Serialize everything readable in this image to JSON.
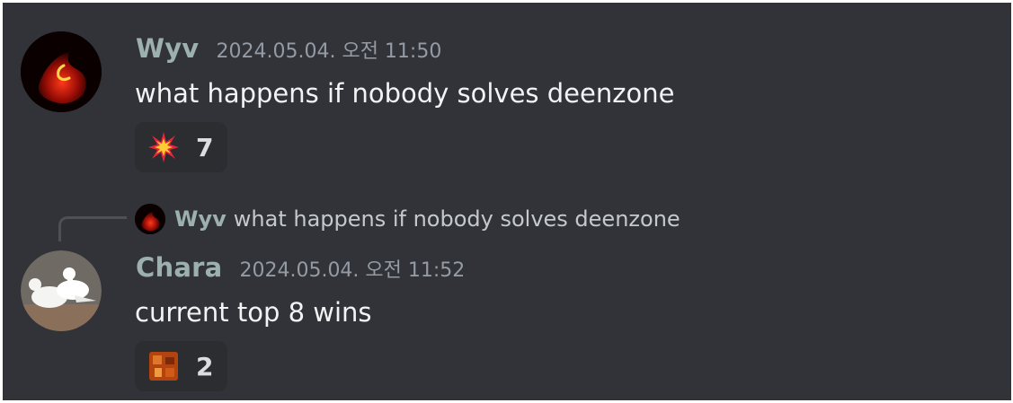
{
  "messages": [
    {
      "username": "Wyv",
      "timestamp": "2024.05.04. 오전 11:50",
      "content": "what happens if nobody solves deenzone",
      "avatar_icon": "red-flame-avatar-icon",
      "reaction": {
        "emoji_icon": "collision-burst-emoji",
        "count": "7"
      }
    },
    {
      "username": "Chara",
      "timestamp": "2024.05.04. 오전 11:52",
      "content": "current top 8 wins",
      "avatar_icon": "white-doves-avatar-icon",
      "reply": {
        "username": "Wyv",
        "content": "what happens if nobody solves deenzone"
      },
      "reaction": {
        "emoji_icon": "orange-custom-emoji",
        "count": "2"
      }
    }
  ],
  "colors": {
    "background": "#313338",
    "username": "#9cb0b0",
    "timestamp": "#949ba4",
    "text": "#f2f3f5",
    "reaction_bg": "#2b2d31"
  }
}
